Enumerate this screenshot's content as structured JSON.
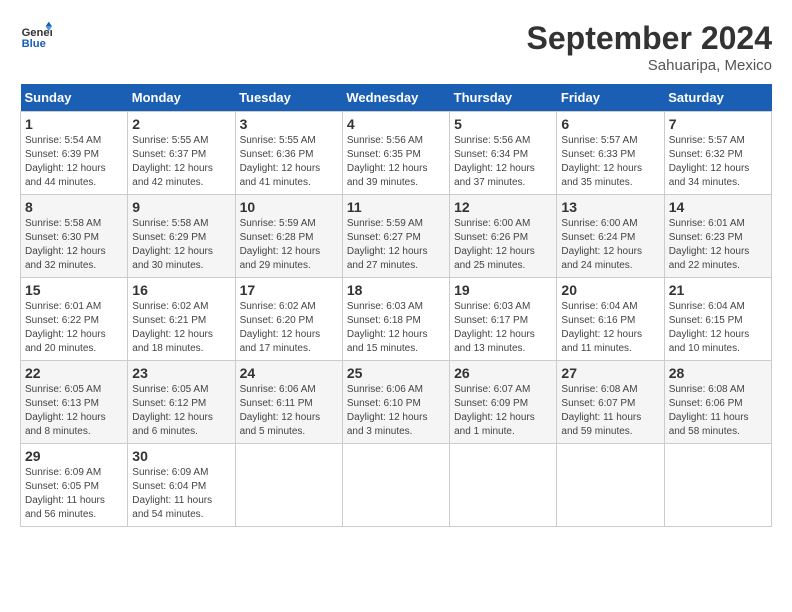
{
  "header": {
    "logo_line1": "General",
    "logo_line2": "Blue",
    "month_year": "September 2024",
    "location": "Sahuaripa, Mexico"
  },
  "days_of_week": [
    "Sunday",
    "Monday",
    "Tuesday",
    "Wednesday",
    "Thursday",
    "Friday",
    "Saturday"
  ],
  "weeks": [
    [
      {
        "day": "1",
        "sunrise": "5:54 AM",
        "sunset": "6:39 PM",
        "daylight": "12 hours and 44 minutes."
      },
      {
        "day": "2",
        "sunrise": "5:55 AM",
        "sunset": "6:37 PM",
        "daylight": "12 hours and 42 minutes."
      },
      {
        "day": "3",
        "sunrise": "5:55 AM",
        "sunset": "6:36 PM",
        "daylight": "12 hours and 41 minutes."
      },
      {
        "day": "4",
        "sunrise": "5:56 AM",
        "sunset": "6:35 PM",
        "daylight": "12 hours and 39 minutes."
      },
      {
        "day": "5",
        "sunrise": "5:56 AM",
        "sunset": "6:34 PM",
        "daylight": "12 hours and 37 minutes."
      },
      {
        "day": "6",
        "sunrise": "5:57 AM",
        "sunset": "6:33 PM",
        "daylight": "12 hours and 35 minutes."
      },
      {
        "day": "7",
        "sunrise": "5:57 AM",
        "sunset": "6:32 PM",
        "daylight": "12 hours and 34 minutes."
      }
    ],
    [
      {
        "day": "8",
        "sunrise": "5:58 AM",
        "sunset": "6:30 PM",
        "daylight": "12 hours and 32 minutes."
      },
      {
        "day": "9",
        "sunrise": "5:58 AM",
        "sunset": "6:29 PM",
        "daylight": "12 hours and 30 minutes."
      },
      {
        "day": "10",
        "sunrise": "5:59 AM",
        "sunset": "6:28 PM",
        "daylight": "12 hours and 29 minutes."
      },
      {
        "day": "11",
        "sunrise": "5:59 AM",
        "sunset": "6:27 PM",
        "daylight": "12 hours and 27 minutes."
      },
      {
        "day": "12",
        "sunrise": "6:00 AM",
        "sunset": "6:26 PM",
        "daylight": "12 hours and 25 minutes."
      },
      {
        "day": "13",
        "sunrise": "6:00 AM",
        "sunset": "6:24 PM",
        "daylight": "12 hours and 24 minutes."
      },
      {
        "day": "14",
        "sunrise": "6:01 AM",
        "sunset": "6:23 PM",
        "daylight": "12 hours and 22 minutes."
      }
    ],
    [
      {
        "day": "15",
        "sunrise": "6:01 AM",
        "sunset": "6:22 PM",
        "daylight": "12 hours and 20 minutes."
      },
      {
        "day": "16",
        "sunrise": "6:02 AM",
        "sunset": "6:21 PM",
        "daylight": "12 hours and 18 minutes."
      },
      {
        "day": "17",
        "sunrise": "6:02 AM",
        "sunset": "6:20 PM",
        "daylight": "12 hours and 17 minutes."
      },
      {
        "day": "18",
        "sunrise": "6:03 AM",
        "sunset": "6:18 PM",
        "daylight": "12 hours and 15 minutes."
      },
      {
        "day": "19",
        "sunrise": "6:03 AM",
        "sunset": "6:17 PM",
        "daylight": "12 hours and 13 minutes."
      },
      {
        "day": "20",
        "sunrise": "6:04 AM",
        "sunset": "6:16 PM",
        "daylight": "12 hours and 11 minutes."
      },
      {
        "day": "21",
        "sunrise": "6:04 AM",
        "sunset": "6:15 PM",
        "daylight": "12 hours and 10 minutes."
      }
    ],
    [
      {
        "day": "22",
        "sunrise": "6:05 AM",
        "sunset": "6:13 PM",
        "daylight": "12 hours and 8 minutes."
      },
      {
        "day": "23",
        "sunrise": "6:05 AM",
        "sunset": "6:12 PM",
        "daylight": "12 hours and 6 minutes."
      },
      {
        "day": "24",
        "sunrise": "6:06 AM",
        "sunset": "6:11 PM",
        "daylight": "12 hours and 5 minutes."
      },
      {
        "day": "25",
        "sunrise": "6:06 AM",
        "sunset": "6:10 PM",
        "daylight": "12 hours and 3 minutes."
      },
      {
        "day": "26",
        "sunrise": "6:07 AM",
        "sunset": "6:09 PM",
        "daylight": "12 hours and 1 minute."
      },
      {
        "day": "27",
        "sunrise": "6:08 AM",
        "sunset": "6:07 PM",
        "daylight": "11 hours and 59 minutes."
      },
      {
        "day": "28",
        "sunrise": "6:08 AM",
        "sunset": "6:06 PM",
        "daylight": "11 hours and 58 minutes."
      }
    ],
    [
      {
        "day": "29",
        "sunrise": "6:09 AM",
        "sunset": "6:05 PM",
        "daylight": "11 hours and 56 minutes."
      },
      {
        "day": "30",
        "sunrise": "6:09 AM",
        "sunset": "6:04 PM",
        "daylight": "11 hours and 54 minutes."
      },
      {
        "day": "",
        "sunrise": "",
        "sunset": "",
        "daylight": ""
      },
      {
        "day": "",
        "sunrise": "",
        "sunset": "",
        "daylight": ""
      },
      {
        "day": "",
        "sunrise": "",
        "sunset": "",
        "daylight": ""
      },
      {
        "day": "",
        "sunrise": "",
        "sunset": "",
        "daylight": ""
      },
      {
        "day": "",
        "sunrise": "",
        "sunset": "",
        "daylight": ""
      }
    ]
  ],
  "labels": {
    "sunrise": "Sunrise:",
    "sunset": "Sunset:",
    "daylight": "Daylight:"
  }
}
